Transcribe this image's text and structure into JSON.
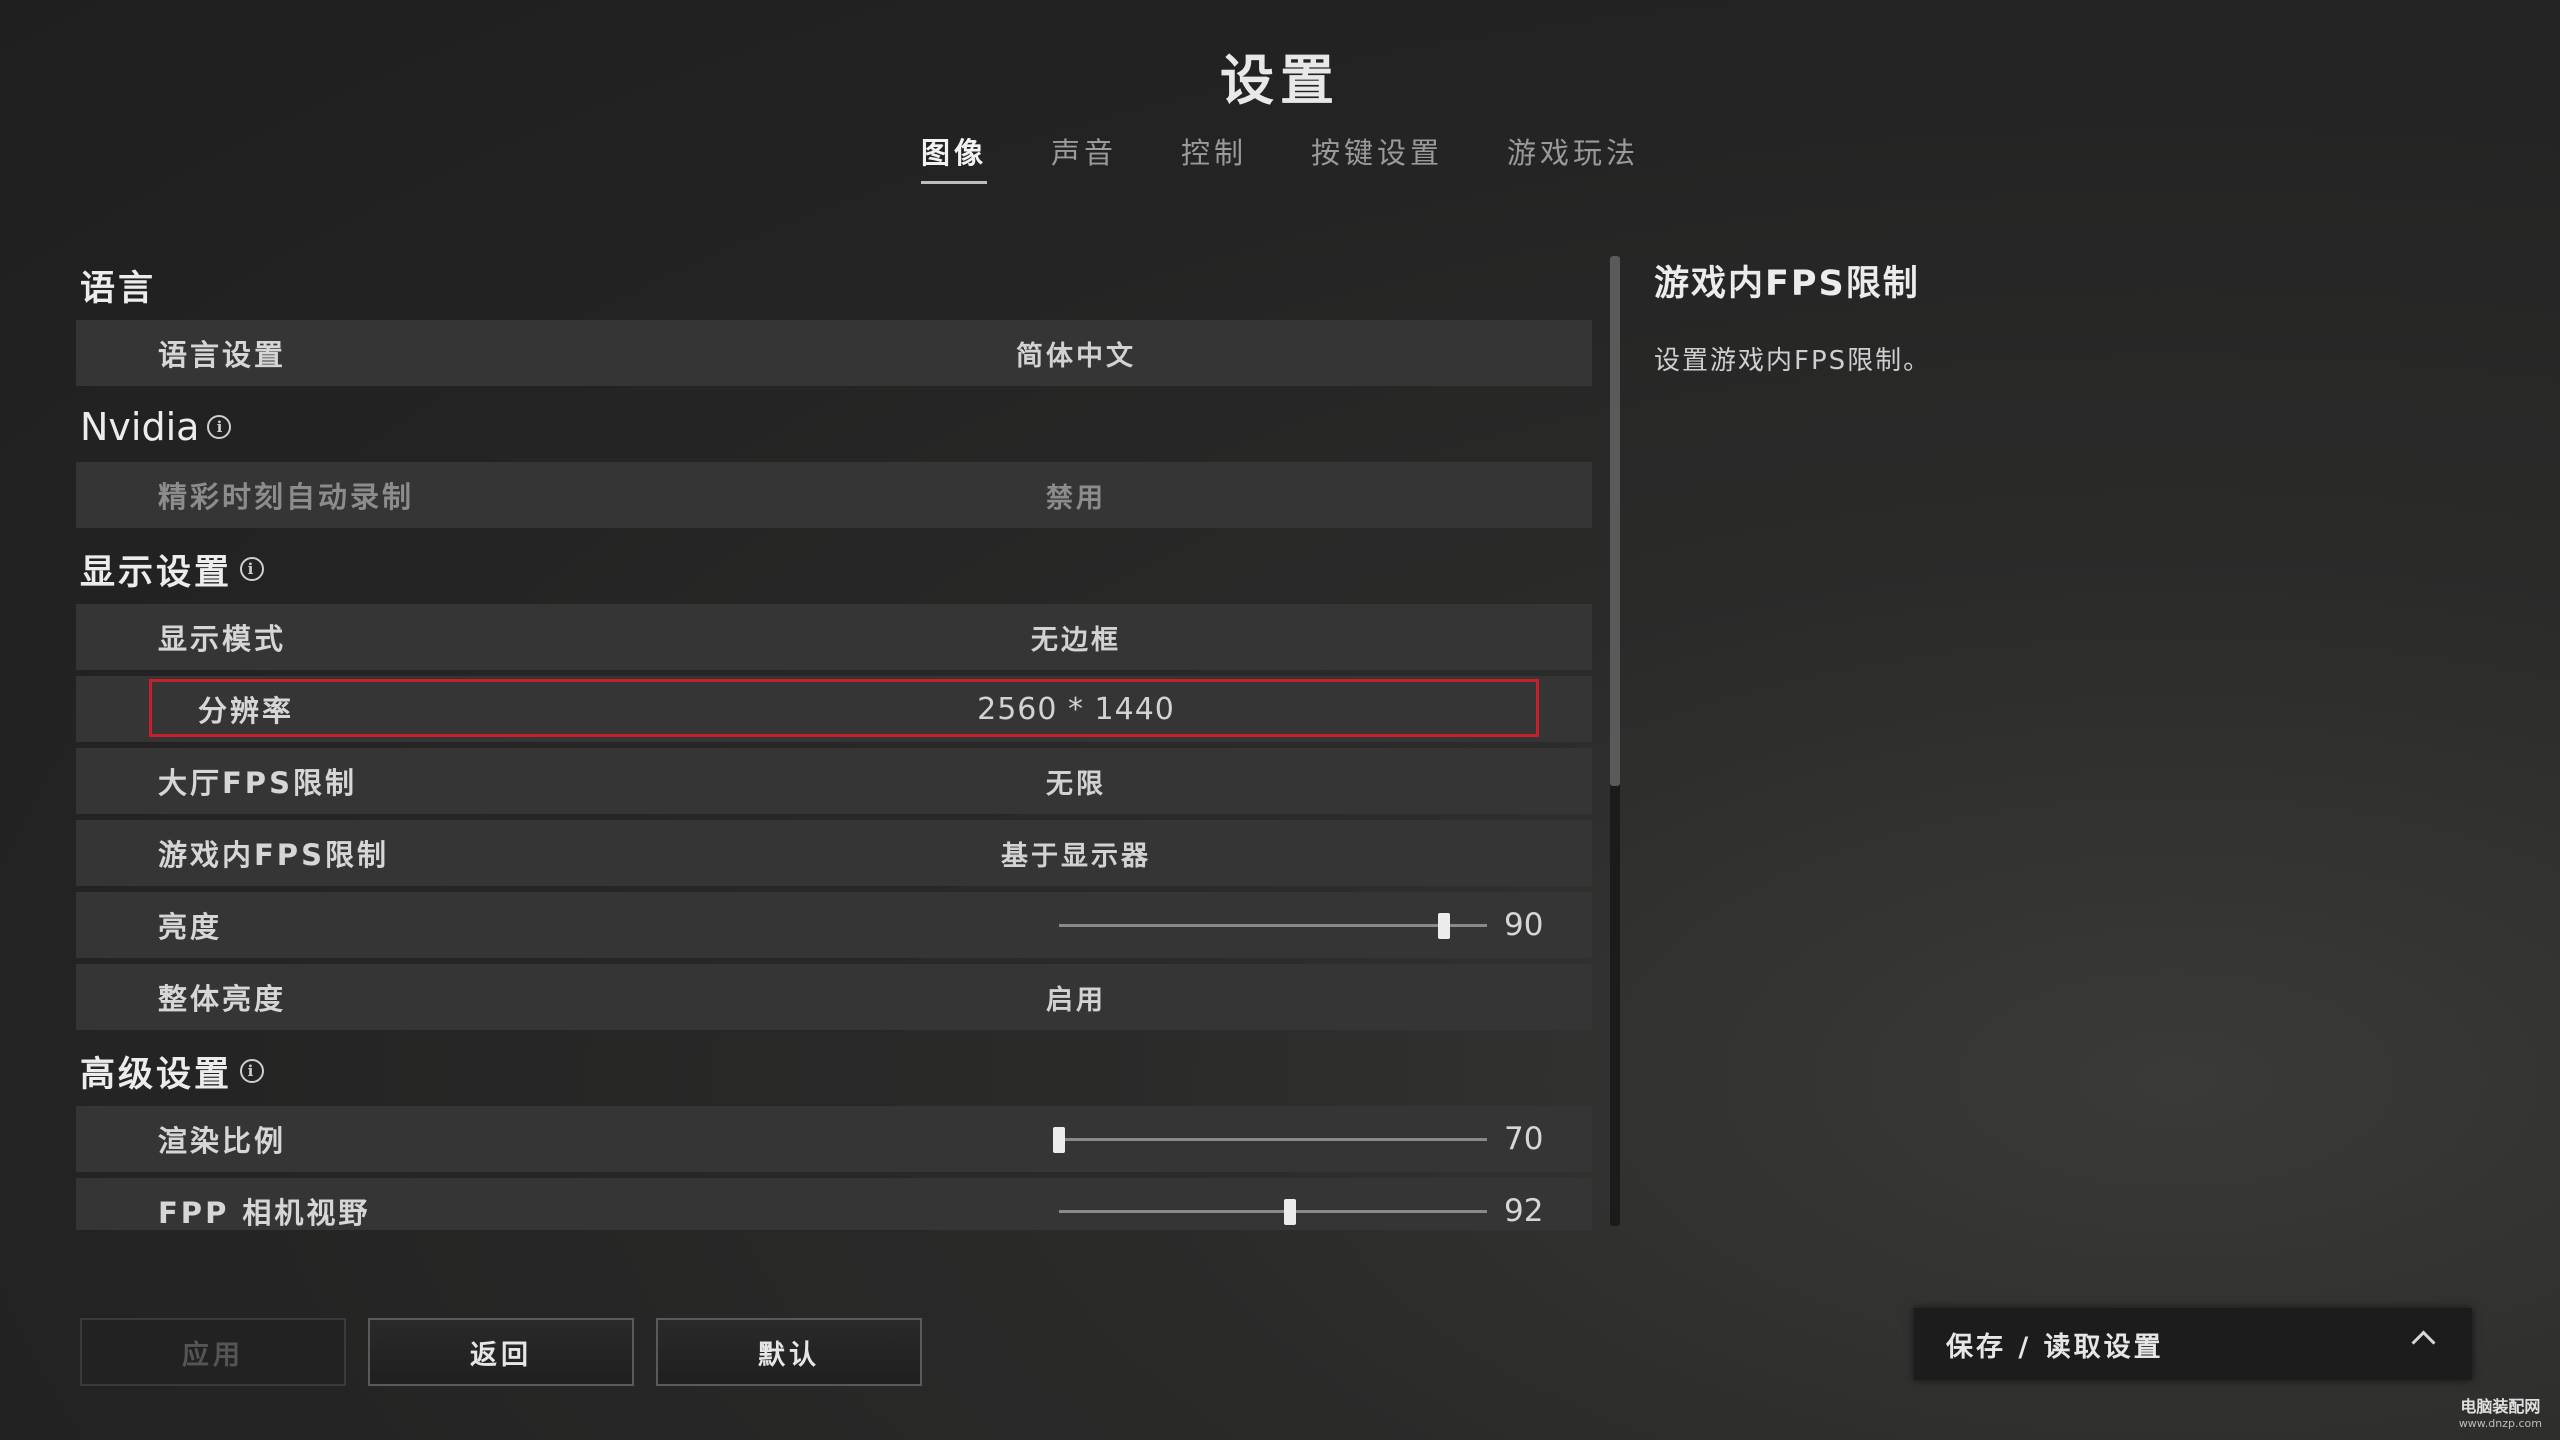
{
  "title": "设置",
  "tabs": [
    {
      "label": "图像",
      "active": true
    },
    {
      "label": "声音",
      "active": false
    },
    {
      "label": "控制",
      "active": false
    },
    {
      "label": "按键设置",
      "active": false
    },
    {
      "label": "游戏玩法",
      "active": false
    }
  ],
  "sections": {
    "language": {
      "title": "语言",
      "rows": [
        {
          "label": "语言设置",
          "value": "简体中文"
        }
      ]
    },
    "nvidia": {
      "title": "Nvidia",
      "rows": [
        {
          "label": "精彩时刻自动录制",
          "value": "禁用"
        }
      ]
    },
    "display": {
      "title": "显示设置",
      "rows": [
        {
          "label": "显示模式",
          "value": "无边框"
        },
        {
          "label": "分辨率",
          "value": "2560 * 1440"
        },
        {
          "label": "大厅FPS限制",
          "value": "无限"
        },
        {
          "label": "游戏内FPS限制",
          "value": "基于显示器"
        },
        {
          "label": "亮度",
          "value": "90",
          "slider_fraction": 0.9
        },
        {
          "label": "整体亮度",
          "value": "启用"
        }
      ]
    },
    "advanced": {
      "title": "高级设置",
      "rows": [
        {
          "label": "渲染比例",
          "value": "70",
          "slider_fraction": 0.0
        },
        {
          "label": "FPP 相机视野",
          "value": "92",
          "slider_fraction": 0.54
        }
      ]
    }
  },
  "detail": {
    "title": "游戏内FPS限制",
    "description": "设置游戏内FPS限制。"
  },
  "buttons": {
    "apply": "应用",
    "back": "返回",
    "default": "默认"
  },
  "save_panel": {
    "label": "保存 / 读取设置"
  },
  "watermark": {
    "main": "电脑装配网",
    "sub": "www.dnzp.com"
  },
  "colors": {
    "selection_border": "#c8202a",
    "background": "#232323",
    "row_background": "#353535"
  }
}
